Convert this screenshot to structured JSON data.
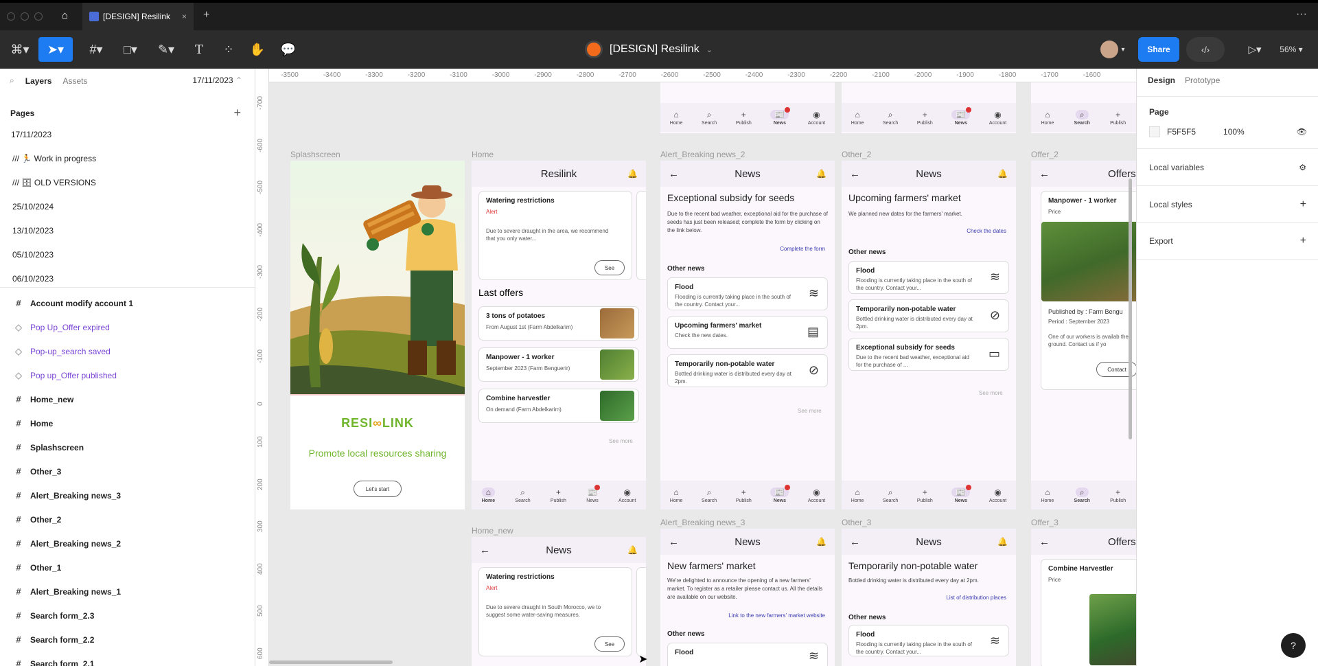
{
  "tabbar": {
    "tab_title": "[DESIGN] Resilink"
  },
  "toolbar": {
    "title": "[DESIGN] Resilink",
    "share": "Share",
    "zoom": "56%"
  },
  "left": {
    "tab_layers": "Layers",
    "tab_assets": "Assets",
    "date": "17/11/2023",
    "pages_label": "Pages",
    "pages": [
      "17/11/2023",
      "/// 🏃 Work in progress",
      "/// 🗄 OLD VERSIONS",
      "25/10/2024",
      "13/10/2023",
      "05/10/2023",
      "06/10/2023"
    ],
    "layers": [
      "Account modify account 1",
      "Pop Up_Offer expired",
      "Pop-up_search saved",
      "Pop up_Offer published",
      "Home_new",
      "Home",
      "Splashscreen",
      "Other_3",
      "Alert_Breaking news_3",
      "Other_2",
      "Alert_Breaking news_2",
      "Other_1",
      "Alert_Breaking news_1",
      "Search form_2.3",
      "Search form_2.2",
      "Search form_2.1"
    ]
  },
  "right": {
    "tab_design": "Design",
    "tab_proto": "Prototype",
    "page_label": "Page",
    "bg_hex": "F5F5F5",
    "bg_pct": "100%",
    "local_vars": "Local variables",
    "local_styles": "Local styles",
    "export": "Export"
  },
  "ruler": {
    "top": [
      "-3500",
      "-3400",
      "-3300",
      "-3200",
      "-3100",
      "-3000",
      "-2900",
      "-2800",
      "-2700",
      "-2600",
      "-2500",
      "-2400",
      "-2300",
      "-2200",
      "-2100",
      "-2000",
      "-1900",
      "-1800",
      "-1700",
      "-1600"
    ],
    "left": [
      "-700",
      "-600",
      "-500",
      "-400",
      "-300",
      "-200",
      "-100",
      "0",
      "100",
      "200",
      "300",
      "400",
      "500",
      "600"
    ]
  },
  "frames": {
    "splash": {
      "label": "Splashscreen",
      "brand_left": "RESI",
      "brand_right": "LINK",
      "tagline": "Promote local resources sharing",
      "btn": "Let's start"
    },
    "home": {
      "label": "Home",
      "title": "Resilink",
      "alert_title": "Watering restrictions",
      "alert_tag": "Alert",
      "alert_body": "Due to severe draught in the area, we recommend that you only water...",
      "see": "See",
      "last_offers": "Last offers",
      "offers": [
        {
          "t": "3 tons of potatoes",
          "s": "From August 1st (Farm Abdelkarim)"
        },
        {
          "t": "Manpower - 1 worker",
          "s": "September 2023 (Farm Benguerir)"
        },
        {
          "t": "Combine harvestler",
          "s": "On demand (Farm Abdelkarim)"
        }
      ],
      "see_more": "See more"
    },
    "abn2": {
      "label": "Alert_Breaking news_2",
      "title": "News",
      "headline": "Exceptional subsidy for seeds",
      "body": "Due to the recent bad weather, exceptional aid for the purchase of seeds has just been released; complete the form by clicking on the link below.",
      "link": "Complete the form",
      "other": "Other news",
      "items": [
        {
          "t": "Flood",
          "s": "Flooding is currently taking place in the south of the country. Contact your..."
        },
        {
          "t": "Upcoming farmers' market",
          "s": "Check the new dates."
        },
        {
          "t": "Temporarily non-potable water",
          "s": "Bottled drinking water is distributed every day at 2pm."
        }
      ],
      "see_more": "See more"
    },
    "other2": {
      "label": "Other_2",
      "title": "News",
      "headline": "Upcoming farmers' market",
      "body": "We planned new dates for the farmers' market.",
      "link": "Check the dates",
      "other": "Other news",
      "items": [
        {
          "t": "Flood",
          "s": "Flooding is currently taking place in the south of the country. Contact your..."
        },
        {
          "t": "Temporarily non-potable water",
          "s": "Bottled drinking water is distributed every day at 2pm."
        },
        {
          "t": "Exceptional subsidy for seeds",
          "s": "Due to the recent bad weather, exceptional aid for the purchase of ..."
        }
      ],
      "see_more": "See more"
    },
    "offer2": {
      "label": "Offer_2",
      "title": "Offers",
      "card_title": "Manpower - 1 worker",
      "price": "Price",
      "pub": "Published by : Farm Bengu",
      "period": "Period : September 2023",
      "body": "One of our workers is availab the ground. Contact us if yo",
      "contact": "Contact"
    },
    "homenew": {
      "label": "Home_new",
      "title": "News",
      "alert_title": "Watering restrictions",
      "alert_tag": "Alert",
      "alert_body": "Due to severe draught in South Morocco, we to suggest some water-saving measures.",
      "see": "See"
    },
    "abn3": {
      "label": "Alert_Breaking news_3",
      "title": "News",
      "headline": "New farmers' market",
      "body": "We're delighted to announce the opening of a new farmers' market. To register as a retailer please contact us. All the details are available on our website.",
      "link": "Link to the new farmers' market website",
      "other": "Other news",
      "item": "Flood"
    },
    "other3": {
      "label": "Other_3",
      "title": "News",
      "headline": "Temporarily non-potable water",
      "body": "Bottled drinking water is distributed every day at 2pm.",
      "link": "List of distribution places",
      "other": "Other news",
      "item_t": "Flood",
      "item_s": "Flooding is currently taking place in the south of the country. Contact your..."
    },
    "offer3": {
      "label": "Offer_3",
      "title": "Offers",
      "card_title": "Combine Harvestler",
      "price": "Price"
    }
  },
  "nav": {
    "home": "Home",
    "search": "Search",
    "publish": "Publish",
    "news": "News",
    "account": "Account"
  },
  "colors": {
    "accent": "#1d7cf2",
    "brand_green": "#6fb52c",
    "brand_orange": "#e8a11a",
    "component_purple": "#7a44d6"
  }
}
